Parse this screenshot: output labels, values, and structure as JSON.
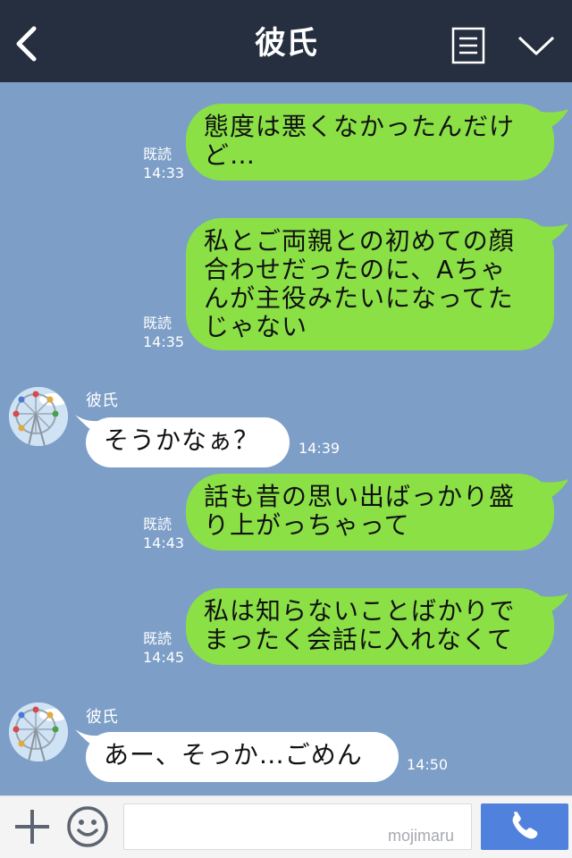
{
  "header": {
    "title": "彼氏",
    "back_icon": "chevron-left-icon",
    "menu_icon": "list-icon",
    "collapse_icon": "chevron-down-icon"
  },
  "messages": [
    {
      "direction": "out",
      "lines": [
        "態度は悪くなかったんだけ",
        "ど…"
      ],
      "read": "既読",
      "time": "14:33"
    },
    {
      "direction": "out",
      "lines": [
        "私とご両親との初めての顔",
        "合わせだったのに、Aちゃ",
        "んが主役みたいになってた",
        "じゃない"
      ],
      "read": "既読",
      "time": "14:35"
    },
    {
      "direction": "in",
      "sender": "彼氏",
      "lines": [
        "そうかなぁ？"
      ],
      "time": "14:39"
    },
    {
      "direction": "out",
      "lines": [
        "話も昔の思い出ばっかり盛",
        "り上がっちゃって"
      ],
      "read": "既読",
      "time": "14:43"
    },
    {
      "direction": "out",
      "lines": [
        "私は知らないことばかりで",
        "まったく会話に入れなくて"
      ],
      "read": "既読",
      "time": "14:45"
    },
    {
      "direction": "in",
      "sender": "彼氏",
      "lines": [
        "あー、そっか…ごめん"
      ],
      "time": "14:50"
    }
  ],
  "input_bar": {
    "plus_icon": "plus-icon",
    "emoji_icon": "smiley-icon",
    "message_value": "",
    "watermark": "mojimaru",
    "call_icon": "phone-icon"
  },
  "colors": {
    "header_bg": "#262f3f",
    "chat_bg": "#7d9ec7",
    "outgoing_bubble": "#8be046",
    "incoming_bubble": "#ffffff",
    "call_button": "#5082dd"
  }
}
